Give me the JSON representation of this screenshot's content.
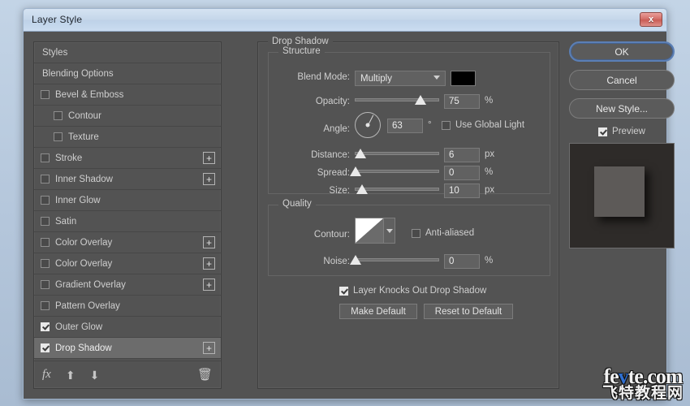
{
  "window": {
    "title": "Layer Style",
    "close_label": "x"
  },
  "styles_panel": {
    "items": [
      {
        "label": "Styles",
        "checkbox": "none",
        "indent": false,
        "plus": false,
        "selected": false
      },
      {
        "label": "Blending Options",
        "checkbox": "none",
        "indent": false,
        "plus": false,
        "selected": false
      },
      {
        "label": "Bevel & Emboss",
        "checkbox": "unchecked",
        "indent": false,
        "plus": false,
        "selected": false
      },
      {
        "label": "Contour",
        "checkbox": "unchecked",
        "indent": true,
        "plus": false,
        "selected": false
      },
      {
        "label": "Texture",
        "checkbox": "unchecked",
        "indent": true,
        "plus": false,
        "selected": false
      },
      {
        "label": "Stroke",
        "checkbox": "unchecked",
        "indent": false,
        "plus": true,
        "selected": false
      },
      {
        "label": "Inner Shadow",
        "checkbox": "unchecked",
        "indent": false,
        "plus": true,
        "selected": false
      },
      {
        "label": "Inner Glow",
        "checkbox": "unchecked",
        "indent": false,
        "plus": false,
        "selected": false
      },
      {
        "label": "Satin",
        "checkbox": "unchecked",
        "indent": false,
        "plus": false,
        "selected": false
      },
      {
        "label": "Color Overlay",
        "checkbox": "unchecked",
        "indent": false,
        "plus": true,
        "selected": false
      },
      {
        "label": "Color Overlay",
        "checkbox": "unchecked",
        "indent": false,
        "plus": true,
        "selected": false
      },
      {
        "label": "Gradient Overlay",
        "checkbox": "unchecked",
        "indent": false,
        "plus": true,
        "selected": false
      },
      {
        "label": "Pattern Overlay",
        "checkbox": "unchecked",
        "indent": false,
        "plus": false,
        "selected": false
      },
      {
        "label": "Outer Glow",
        "checkbox": "checked",
        "indent": false,
        "plus": false,
        "selected": false
      },
      {
        "label": "Drop Shadow",
        "checkbox": "checked",
        "indent": false,
        "plus": true,
        "selected": true
      }
    ],
    "toolbar": {
      "fx": "fx",
      "move_up": "⬆",
      "move_down": "⬇",
      "delete": "🗑"
    }
  },
  "effect": {
    "title": "Drop Shadow",
    "structure": {
      "legend": "Structure",
      "blend_mode_label": "Blend Mode:",
      "blend_mode_value": "Multiply",
      "shadow_color": "#000000",
      "opacity_label": "Opacity:",
      "opacity_value": "75",
      "opacity_unit": "%",
      "angle_label": "Angle:",
      "angle_value": "63",
      "angle_unit": "°",
      "use_global_light_label": "Use Global Light",
      "use_global_light_checked": false,
      "distance_label": "Distance:",
      "distance_value": "6",
      "distance_unit": "px",
      "spread_label": "Spread:",
      "spread_value": "0",
      "spread_unit": "%",
      "size_label": "Size:",
      "size_value": "10",
      "size_unit": "px"
    },
    "quality": {
      "legend": "Quality",
      "contour_label": "Contour:",
      "anti_aliased_label": "Anti-aliased",
      "anti_aliased_checked": false,
      "noise_label": "Noise:",
      "noise_value": "0",
      "noise_unit": "%"
    },
    "footer": {
      "knockout_label": "Layer Knocks Out Drop Shadow",
      "knockout_checked": true,
      "make_default_label": "Make Default",
      "reset_default_label": "Reset to Default"
    }
  },
  "actions": {
    "ok_label": "OK",
    "cancel_label": "Cancel",
    "new_style_label": "New Style...",
    "preview_label": "Preview",
    "preview_checked": true
  },
  "watermark": {
    "line1_a": "fe",
    "line1_v": "v",
    "line1_b": "te.com",
    "line2": "飞特教程网"
  }
}
